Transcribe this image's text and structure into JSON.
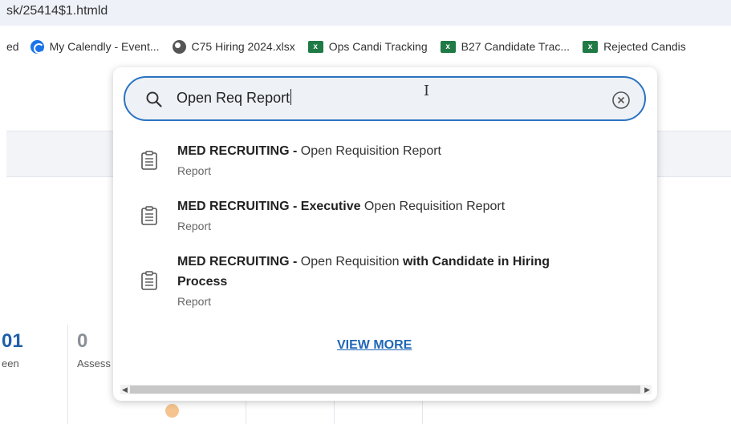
{
  "browser": {
    "url": "sk/25414$1.htmld"
  },
  "bookmarks": [
    {
      "label": "ed",
      "icon": "none"
    },
    {
      "label": "My Calendly - Event...",
      "icon": "calendly-icon"
    },
    {
      "label": "C75 Hiring 2024.xlsx",
      "icon": "globe-icon"
    },
    {
      "label": "Ops Candi Tracking",
      "icon": "excel-icon"
    },
    {
      "label": "B27 Candidate Trac...",
      "icon": "excel-icon"
    },
    {
      "label": "Rejected Candis",
      "icon": "excel-icon"
    }
  ],
  "search": {
    "query": "Open Req Report"
  },
  "results": [
    {
      "title_parts": [
        {
          "text": "MED RECRUITING -",
          "bold": true
        },
        {
          "text": " Open Requisition ",
          "bold": false
        },
        {
          "text": "Report",
          "bold": false
        }
      ],
      "type": "Report"
    },
    {
      "title_parts": [
        {
          "text": "MED RECRUITING - Executive",
          "bold": true
        },
        {
          "text": " Open Requisition ",
          "bold": false
        },
        {
          "text": "Report",
          "bold": false
        }
      ],
      "type": "Report"
    },
    {
      "title_parts": [
        {
          "text": "MED RECRUITING -",
          "bold": true
        },
        {
          "text": " Open Requisition ",
          "bold": false
        },
        {
          "text": "with Candidate in Hiring Process",
          "bold": true
        }
      ],
      "type": "Report"
    }
  ],
  "view_more_label": "VIEW MORE",
  "background_stats": [
    {
      "value": "01",
      "label": "een"
    },
    {
      "value": "0",
      "label": "Assess"
    }
  ],
  "colors": {
    "accent": "#2b73c2",
    "link": "#1f67b8"
  }
}
